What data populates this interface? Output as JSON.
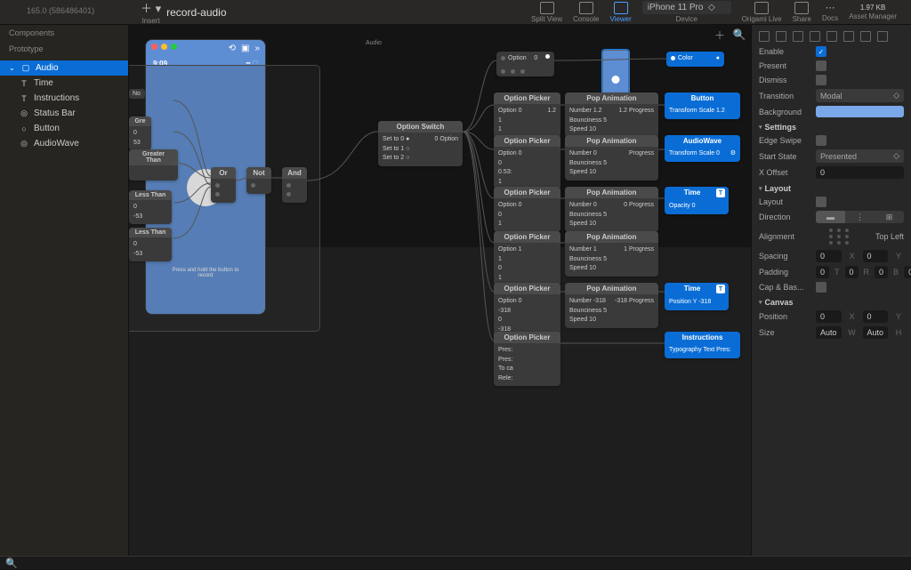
{
  "toolbar": {
    "version": "165.0 (586486401)",
    "insert_label": "Insert",
    "title": "record-audio",
    "split_view": "Split View",
    "console": "Console",
    "viewer": "Viewer",
    "device": "iPhone 11 Pro",
    "device_label": "Device",
    "origami_live": "Origami Live",
    "share": "Share",
    "docs": "Docs",
    "file_size": "1.97 KB",
    "asset_manager": "Asset Manager"
  },
  "sidebar": {
    "section1": "Components",
    "section2": "Prototype",
    "items": [
      {
        "label": "Audio",
        "icon": "▢"
      },
      {
        "label": "Time",
        "icon": "T"
      },
      {
        "label": "Instructions",
        "icon": "T"
      },
      {
        "label": "Status Bar",
        "icon": "◎"
      },
      {
        "label": "Button",
        "icon": "○"
      },
      {
        "label": "AudioWave",
        "icon": "◎"
      }
    ]
  },
  "phone": {
    "time": "9:09",
    "instruction": "Press and hold the button to record"
  },
  "artboard_label": "Audio",
  "canvas": {
    "color_patch": {
      "label": "Color",
      "port": "●"
    },
    "option_node": {
      "label": "Option",
      "val": "0"
    }
  },
  "patches": {
    "option_switch": {
      "title": "Option Switch",
      "rows": [
        "Set to 0 ●",
        "Set to 1 ○",
        "Set to 2 ○"
      ],
      "out": "0   Option"
    },
    "no": "No",
    "gre1": "Gre",
    "gre2": {
      "title": "Greater Than",
      "rows": [
        "0",
        "53"
      ]
    },
    "gre3": {
      "title": "Greater Than"
    },
    "less1": {
      "title": "Less Than",
      "rows": [
        "0",
        "-53"
      ]
    },
    "less2": {
      "title": "Less Than",
      "rows": [
        "0",
        "-53"
      ]
    },
    "or": "Or",
    "not": "Not",
    "and": "And",
    "op1": {
      "title": "Option Picker",
      "rows": [
        "Option   0",
        "1",
        "1"
      ],
      "out": "1.2"
    },
    "op2": {
      "title": "Option Picker",
      "rows": [
        "Option   0",
        "0",
        "0.53:",
        "1"
      ]
    },
    "op3": {
      "title": "Option Picker",
      "rows": [
        "Option   0",
        "0",
        "1"
      ]
    },
    "op4": {
      "title": "Option Picker",
      "rows": [
        "Option   1",
        "1",
        "0",
        "1"
      ]
    },
    "op5": {
      "title": "Option Picker",
      "rows": [
        "Option   0",
        "-318",
        "0",
        "-318"
      ]
    },
    "op6": {
      "title": "Option Picker",
      "rows": [
        "Pres:",
        "Pres:",
        "To ca",
        "Rele:"
      ]
    },
    "pop1": {
      "title": "Pop Animation",
      "rows": [
        "Number   1.2",
        "Bounciness   5",
        "Speed   10"
      ],
      "out": "1.2   Progress"
    },
    "pop2": {
      "title": "Pop Animation",
      "rows": [
        "Number   0",
        "Bounciness   5",
        "Speed   10"
      ],
      "out": "Progress"
    },
    "pop3": {
      "title": "Pop Animation",
      "rows": [
        "Number   0",
        "Bounciness   5",
        "Speed   10"
      ],
      "out": "0   Progress"
    },
    "pop4": {
      "title": "Pop Animation",
      "rows": [
        "Number   1",
        "Bounciness   5",
        "Speed   10"
      ],
      "out": "1   Progress"
    },
    "pop5": {
      "title": "Pop Animation",
      "rows": [
        "Number   -318",
        "Bounciness   5",
        "Speed   10"
      ],
      "out": "-318   Progress"
    },
    "btn": {
      "title": "Button",
      "row": "Transform Scale   1.2"
    },
    "wave": {
      "title": "AudioWave",
      "row": "Transform Scale   0"
    },
    "time1": {
      "title": "Time",
      "row": "Opacity   0"
    },
    "time2": {
      "title": "Time",
      "row": "Position Y   -318"
    },
    "instr": {
      "title": "Instructions",
      "row": "Typography Text   Pres:"
    }
  },
  "inspector": {
    "enable": "Enable",
    "present": "Present",
    "dismiss": "Dismiss",
    "transition": "Transition",
    "transition_val": "Modal",
    "background": "Background",
    "settings": "Settings",
    "edge_swipe": "Edge Swipe",
    "start_state": "Start State",
    "start_state_val": "Presented",
    "x_offset": "X Offset",
    "x_offset_val": "0",
    "layout_h": "Layout",
    "layout": "Layout",
    "direction": "Direction",
    "alignment": "Alignment",
    "alignment_val": "Top Left",
    "spacing": "Spacing",
    "spacing_x": "0",
    "spacing_y": "0",
    "padding": "Padding",
    "padding_t": "0",
    "padding_r": "0",
    "padding_b": "0",
    "padding_l": "0",
    "cap_bas": "Cap & Bas...",
    "canvas_h": "Canvas",
    "position": "Position",
    "pos_x": "0",
    "pos_y": "0",
    "size": "Size",
    "size_w": "Auto",
    "size_h": "Auto"
  }
}
